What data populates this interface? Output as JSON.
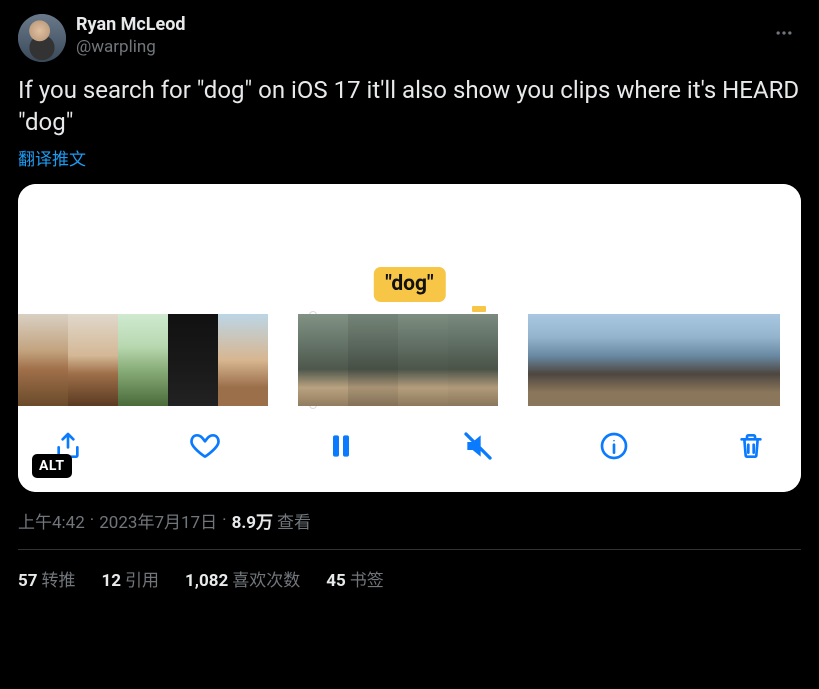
{
  "author": {
    "display_name": "Ryan McLeod",
    "handle": "@warpling"
  },
  "tweet_text": "If you search for \"dog\" on iOS 17 it'll also show you clips where it's HEARD \"dog\"",
  "translate_label": "翻译推文",
  "media": {
    "caption_tag": "\"dog\"",
    "alt_badge": "ALT",
    "controls": {
      "share": "share",
      "like": "like",
      "pause": "pause",
      "mute": "mute",
      "info": "info",
      "delete": "delete"
    }
  },
  "meta": {
    "time": "上午4:42",
    "date": "2023年7月17日",
    "views_count": "8.9万",
    "views_label": "查看"
  },
  "stats": {
    "retweets": {
      "count": "57",
      "label": "转推"
    },
    "quotes": {
      "count": "12",
      "label": "引用"
    },
    "likes": {
      "count": "1,082",
      "label": "喜欢次数"
    },
    "bookmarks": {
      "count": "45",
      "label": "书签"
    }
  }
}
